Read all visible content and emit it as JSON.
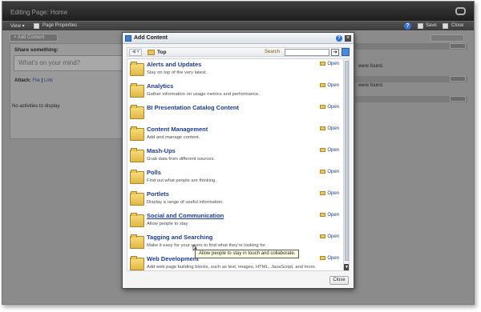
{
  "app": {
    "title": "Editing Page: Home",
    "menu": {
      "view": "View ▾",
      "page_properties": "Page Properties",
      "save": "Save",
      "close": "Close"
    }
  },
  "page": {
    "add_content": "+ Add Content",
    "share_title": "Share something:",
    "status_placeholder": "What's on your mind?",
    "attach_label": "Attach:",
    "attach_file": "File",
    "attach_link": "Link",
    "no_activities": "No activities to display.",
    "right_panel_texts": [
      "were found.",
      "were found."
    ]
  },
  "dialog": {
    "title": "Add Content",
    "breadcrumb": "Top",
    "search_label": "Search",
    "search_value": "",
    "open_label": "Open",
    "close_button": "Close",
    "tooltip": "Allow people to stay in touch and collaborate.",
    "items": [
      {
        "name": "Alerts and Updates",
        "desc": "Stay on top of the very latest.",
        "icon": "alerts-folder-icon"
      },
      {
        "name": "Analytics",
        "desc": "Gather information on usage metrics and performance.",
        "icon": "analytics-folder-icon"
      },
      {
        "name": "BI Presentation Catalog Content",
        "desc": "",
        "icon": "folder-icon"
      },
      {
        "name": "Content Management",
        "desc": "Add and manage content.",
        "icon": "content-folder-icon"
      },
      {
        "name": "Mash-Ups",
        "desc": "Grab data from different sources.",
        "icon": "mashups-folder-icon"
      },
      {
        "name": "Polls",
        "desc": "Find out what people are thinking.",
        "icon": "polls-folder-icon"
      },
      {
        "name": "Portlets",
        "desc": "Display a range of useful information.",
        "icon": "portlets-folder-icon"
      },
      {
        "name": "Social and Communication",
        "desc": "Allow people to stay",
        "icon": "social-folder-icon"
      },
      {
        "name": "Tagging and Searching",
        "desc": "Make it easy for your users to find what they're looking for.",
        "icon": "tagging-folder-icon"
      },
      {
        "name": "Web Development",
        "desc": "Add web page building blocks, such as text, images, HTML, JavaScript, and more.",
        "icon": "webdev-folder-icon"
      }
    ]
  }
}
